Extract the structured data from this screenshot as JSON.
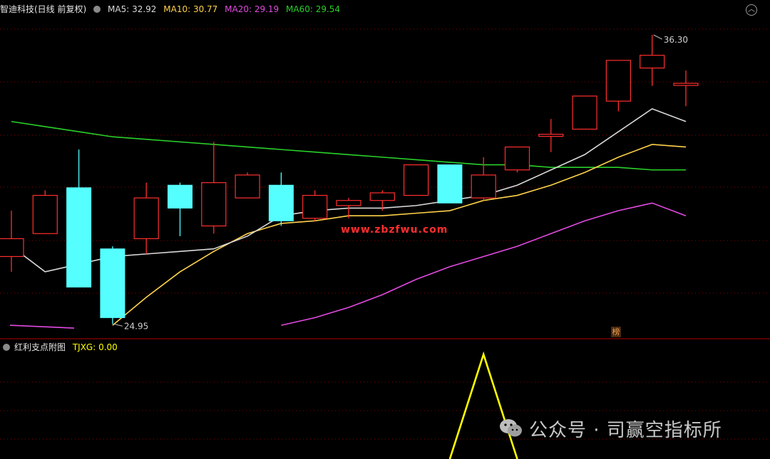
{
  "header": {
    "stock_title": "智迪科技(日线 前复权)",
    "ma5": "MA5: 32.92",
    "ma10": "MA10: 30.77",
    "ma20": "MA20: 29.19",
    "ma60": "MA60: 29.54",
    "collapse_icon": "chevron-up-icon"
  },
  "colors": {
    "up": "#ff2e2e",
    "down": "#55ffff",
    "ma5": "#d9d9d9",
    "ma10": "#ffd24a",
    "ma20": "#e24ae2",
    "ma60": "#2ad02a",
    "indicator": "#ffff00",
    "grid": "#8b0000"
  },
  "sub_header": {
    "indicator_name": "红利支点附图",
    "tjxg": "TJXG: 0.00"
  },
  "watermark_site": "www.zbzfwu.com",
  "bang_label": "榜",
  "footer_watermark": "公众号 · 司赢空指标所",
  "chart_data": {
    "type": "candlestick",
    "title": "智迪科技(日线 前复权)",
    "max_label": "36.30",
    "min_label": "24.95",
    "ylim": [
      24.4,
      37.0
    ],
    "candles": [
      {
        "o": 27.6,
        "h": 29.4,
        "l": 27.0,
        "c": 28.3
      },
      {
        "o": 28.5,
        "h": 30.2,
        "l": 28.5,
        "c": 30.0
      },
      {
        "o": 30.3,
        "h": 31.8,
        "l": 26.4,
        "c": 26.4
      },
      {
        "o": 27.9,
        "h": 28.0,
        "l": 24.95,
        "c": 25.2
      },
      {
        "o": 28.3,
        "h": 30.5,
        "l": 27.7,
        "c": 29.9
      },
      {
        "o": 30.4,
        "h": 30.5,
        "l": 28.4,
        "c": 29.5
      },
      {
        "o": 28.8,
        "h": 32.1,
        "l": 28.5,
        "c": 30.5
      },
      {
        "o": 29.9,
        "h": 30.9,
        "l": 29.9,
        "c": 30.8
      },
      {
        "o": 30.4,
        "h": 30.9,
        "l": 28.8,
        "c": 29.0
      },
      {
        "o": 29.1,
        "h": 30.2,
        "l": 29.0,
        "c": 30.0
      },
      {
        "o": 29.6,
        "h": 29.9,
        "l": 29.1,
        "c": 29.8
      },
      {
        "o": 29.8,
        "h": 30.2,
        "l": 29.4,
        "c": 30.1
      },
      {
        "o": 30.0,
        "h": 31.2,
        "l": 30.0,
        "c": 31.2
      },
      {
        "o": 31.2,
        "h": 31.2,
        "l": 29.7,
        "c": 29.7
      },
      {
        "o": 29.9,
        "h": 31.5,
        "l": 29.8,
        "c": 30.8
      },
      {
        "o": 31.0,
        "h": 31.7,
        "l": 30.9,
        "c": 31.9
      },
      {
        "o": 32.4,
        "h": 33.0,
        "l": 31.7,
        "c": 32.4
      },
      {
        "o": 32.6,
        "h": 33.8,
        "l": 32.6,
        "c": 33.9
      },
      {
        "o": 33.7,
        "h": 34.6,
        "l": 33.3,
        "c": 35.3
      },
      {
        "o": 35.0,
        "h": 36.3,
        "l": 34.3,
        "c": 35.5
      },
      {
        "o": 34.4,
        "h": 34.9,
        "l": 33.5,
        "c": 34.4
      }
    ],
    "ma5": [
      28.0,
      27.0,
      27.3,
      27.6,
      27.7,
      27.8,
      27.9,
      28.4,
      29.2,
      29.4,
      29.5,
      29.5,
      29.6,
      29.8,
      30.0,
      30.4,
      31.0,
      31.6,
      32.5,
      33.4,
      32.9
    ],
    "ma10": [
      null,
      null,
      null,
      24.9,
      26.0,
      27.0,
      27.8,
      28.5,
      28.9,
      29.0,
      29.2,
      29.2,
      29.3,
      29.4,
      29.8,
      30.0,
      30.4,
      30.9,
      31.5,
      32.0,
      31.9
    ],
    "ma20": [
      24.9,
      null,
      null,
      null,
      null,
      null,
      null,
      null,
      24.9,
      25.2,
      25.6,
      26.1,
      26.7,
      27.2,
      27.6,
      28.0,
      28.5,
      29.0,
      29.4,
      29.7,
      29.2
    ],
    "ma60": [
      32.9,
      32.7,
      32.5,
      32.3,
      32.2,
      32.1,
      32.0,
      31.9,
      31.8,
      31.7,
      31.6,
      31.5,
      31.4,
      31.3,
      31.2,
      31.2,
      31.1,
      31.1,
      31.1,
      31.0,
      31.0
    ],
    "indicator_x": [
      13,
      14,
      15
    ],
    "indicator_y": [
      0,
      1,
      0
    ]
  }
}
